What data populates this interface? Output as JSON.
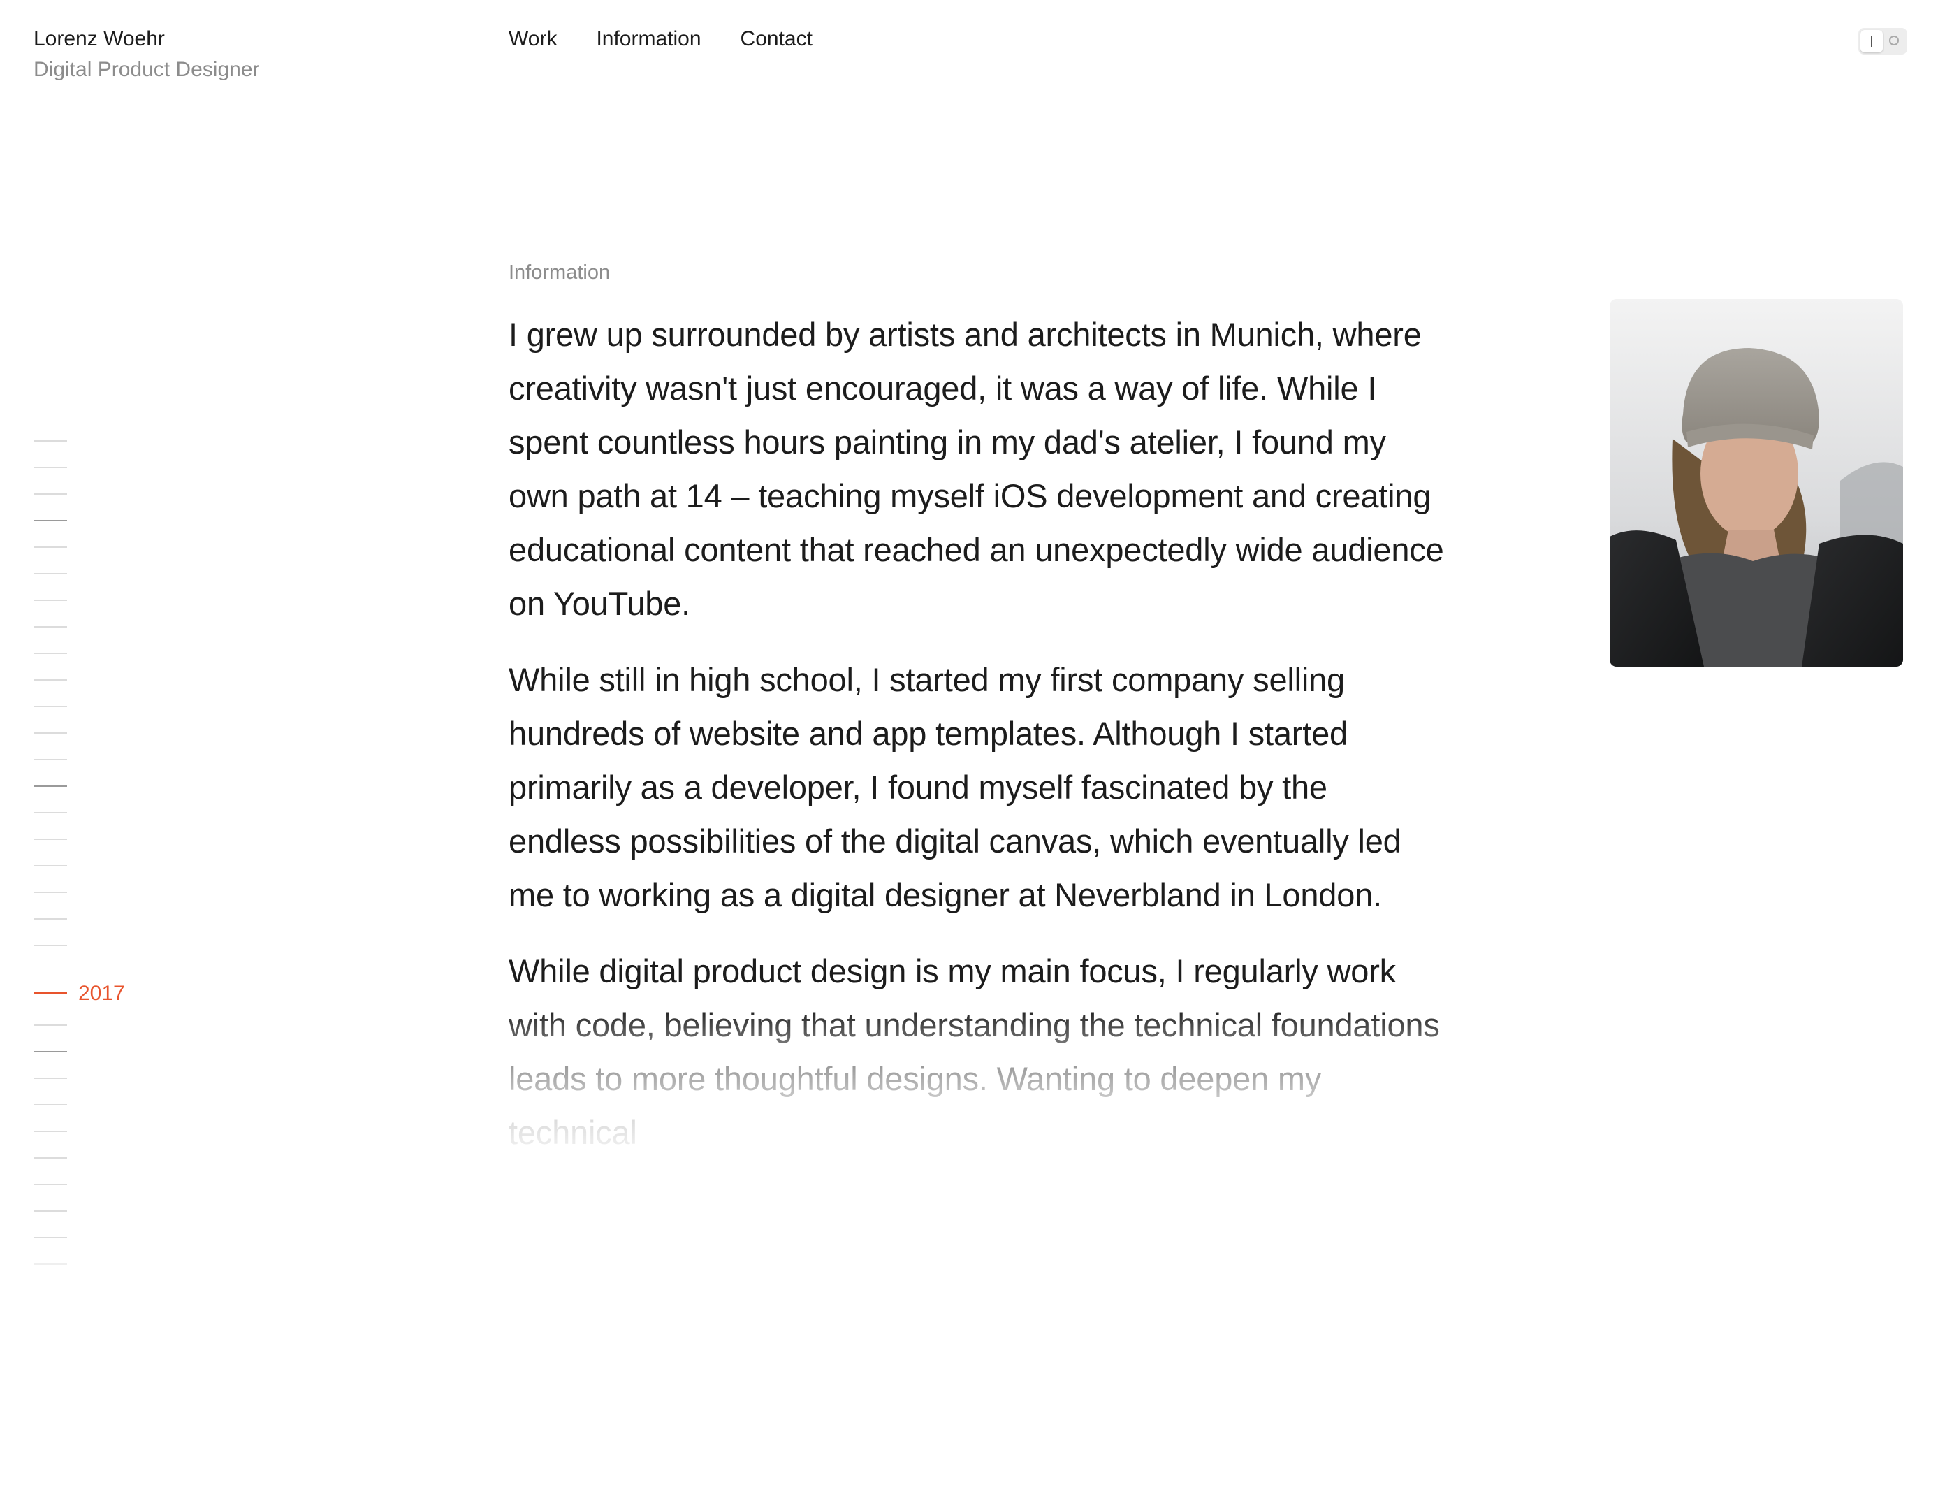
{
  "brand": {
    "name": "Lorenz Woehr",
    "role": "Digital Product Designer"
  },
  "nav": {
    "items": [
      {
        "label": "Work"
      },
      {
        "label": "Information"
      },
      {
        "label": "Contact"
      }
    ]
  },
  "theme_toggle": {
    "state": "on",
    "icon_on": "bar-icon",
    "icon_off": "circle-icon"
  },
  "timeline": {
    "tick_count": 32,
    "active_year": "2017",
    "active_color": "#e8542d"
  },
  "section": {
    "label": "Information"
  },
  "content": {
    "paragraphs": [
      "I grew up surrounded by artists and architects in Munich, where creativity wasn't just encouraged, it was a way of life. While I spent countless hours painting in my dad's atelier, I found my own path at 14 – teaching myself iOS development and creating educational content that reached an unexpectedly wide audience on YouTube.",
      "While still in high school, I started my first company selling hundreds of website and app templates. Although I started primarily as a developer, I found myself fascinated by the endless possibilities of the digital canvas, which eventually led me to working as a digital designer at Neverbland in London.",
      "While digital product design is my main focus, I regularly work with code, believing that understanding the technical foundations leads to more thoughtful designs. Wanting to deepen my technical"
    ]
  },
  "colors": {
    "text": "#1c1c1c",
    "muted": "#8c8c8c",
    "accent": "#e8542d",
    "background": "#ffffff"
  }
}
